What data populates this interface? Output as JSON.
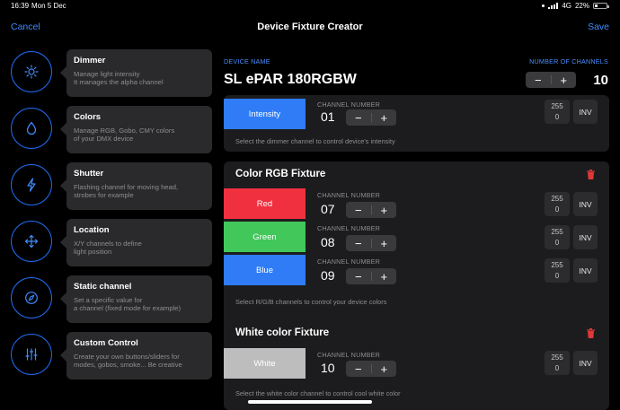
{
  "status": {
    "time": "16:39",
    "date": "Mon 5 Dec",
    "network": "4G",
    "battery": "22%",
    "battery_level": 0.22
  },
  "nav": {
    "cancel": "Cancel",
    "title": "Device Fixture Creator",
    "save": "Save"
  },
  "sidebar": {
    "items": [
      {
        "title": "Dimmer",
        "desc": "Manage light intensity\nIt manages the alpha channel",
        "icon": "sun-icon"
      },
      {
        "title": "Colors",
        "desc": "Manage RGB, Gobo, CMY colors\nof your DMX device",
        "icon": "drop-icon"
      },
      {
        "title": "Shutter",
        "desc": "Flashing channel for moving head,\nstrobes for example",
        "icon": "bolt-icon"
      },
      {
        "title": "Location",
        "desc": "X/Y channels to define\nlight position",
        "icon": "move-arrows-icon"
      },
      {
        "title": "Static channel",
        "desc": "Set a specific value for\na channel (fixed mode for example)",
        "icon": "compass-icon"
      },
      {
        "title": "Custom Control",
        "desc": "Create your own buttons/sliders for\nmodes, gobos, smoke... Be creative",
        "icon": "sliders-icon"
      }
    ]
  },
  "device": {
    "name_label": "DEVICE NAME",
    "name": "SL ePAR 180RGBW",
    "channels_label": "NUMBER OF CHANNELS",
    "channels": "10",
    "minus": "−",
    "plus": "+"
  },
  "labels": {
    "channel_number": "CHANNEL NUMBER",
    "max": "255",
    "min": "0",
    "inv": "INV",
    "minus": "−",
    "plus": "+"
  },
  "panels": {
    "dimmer": {
      "channels": [
        {
          "name": "Intensity",
          "number": "01",
          "color": "#2f7cf6"
        }
      ],
      "footer": "Select the dimmer channel to control device's intensity"
    },
    "rgb": {
      "title": "Color RGB Fixture",
      "channels": [
        {
          "name": "Red",
          "number": "07",
          "color": "#f0303f"
        },
        {
          "name": "Green",
          "number": "08",
          "color": "#41c75a"
        },
        {
          "name": "Blue",
          "number": "09",
          "color": "#2f7cf6"
        }
      ],
      "footer": "Select R/G/B channels to control your device colors"
    },
    "white": {
      "title": "White color Fixture",
      "channels": [
        {
          "name": "White",
          "number": "10",
          "color": "#bdbdbd"
        }
      ],
      "footer": "Select the white color channel to control cool white color"
    }
  },
  "colors": {
    "accent": "#3f8cff",
    "danger": "#e03838",
    "panel": "#1c1c1e"
  }
}
